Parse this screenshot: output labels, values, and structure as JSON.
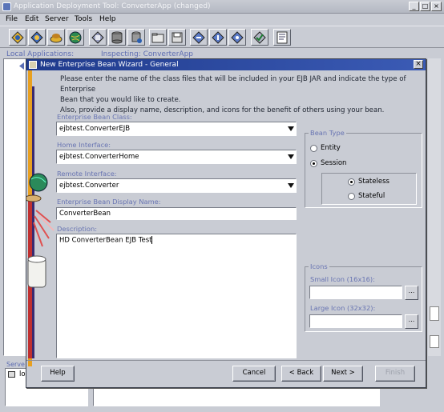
{
  "window": {
    "title": "Application Deployment Tool: ConverterApp (changed)",
    "min_label": "_",
    "max_label": "□",
    "close_label": "×"
  },
  "menubar": {
    "items": [
      "File",
      "Edit",
      "Server",
      "Tools",
      "Help"
    ]
  },
  "toolbar": {
    "icons": [
      "new-application-icon",
      "new-ejb-icon",
      "open-icon",
      "server-globe-icon",
      "new-component-icon",
      "database-icon",
      "deploy-icon",
      "folder-icon",
      "save-icon",
      "tool-icon-1",
      "tool-icon-2",
      "tool-icon-3",
      "verify-icon",
      "properties-icon"
    ]
  },
  "background": {
    "local_apps": "Local Applications:",
    "inspecting": "Inspecting: ConverterApp",
    "servers": "Serve",
    "server_item": "lo"
  },
  "dialog": {
    "title": "New Enterprise Bean Wizard - General",
    "intro": [
      "Please enter the name of the class files that will be included in your EJB JAR and indicate the type of Enterprise",
      "Bean that you would like to create.",
      "Also, provide a display name, description, and icons for the benefit of others using your bean."
    ],
    "bean_class": {
      "label": "Enterprise Bean Class:",
      "value": "ejbtest.ConverterEJB"
    },
    "home_iface": {
      "label": "Home Interface:",
      "value": "ejbtest.ConverterHome"
    },
    "remote_iface": {
      "label": "Remote Interface:",
      "value": "ejbtest.Converter"
    },
    "display_name": {
      "label": "Enterprise Bean Display Name:",
      "value": "ConverterBean"
    },
    "description": {
      "label": "Description:",
      "value": "HD ConverterBean EJB Test"
    },
    "bean_type": {
      "label": "Bean Type",
      "entity": "Entity",
      "session": "Session",
      "stateless": "Stateless",
      "stateful": "Stateful",
      "selected_type": "Session",
      "selected_session": "Stateless"
    },
    "icons": {
      "label": "Icons",
      "small": "Small Icon (16x16):",
      "large": "Large Icon (32x32):",
      "browse": "..."
    },
    "buttons": {
      "help": "Help",
      "cancel": "Cancel",
      "back": "< Back",
      "next": "Next >",
      "finish": "Finish"
    }
  }
}
